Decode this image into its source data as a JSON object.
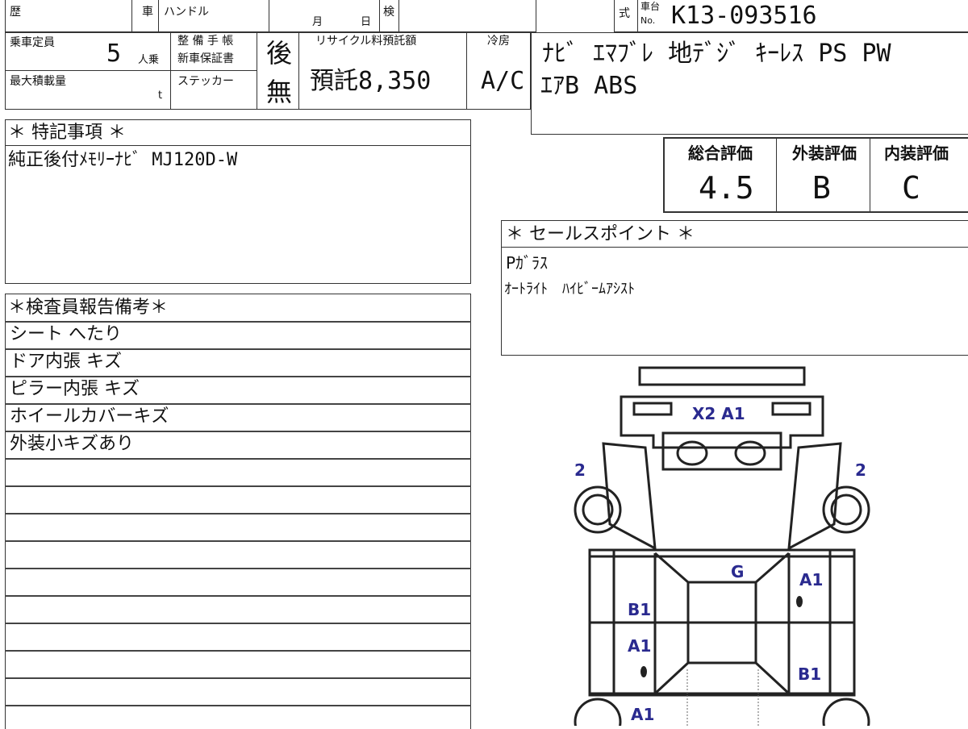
{
  "header": {
    "history_label": "歴",
    "car_label": "車",
    "handle_label": "ハンドル",
    "month_label": "月",
    "day_label": "日",
    "inspection_label": "検",
    "model_label": "式",
    "chassis_label_top": "車台",
    "chassis_label_bottom": "No.",
    "chassis_no": "K13-093516"
  },
  "specs": {
    "capacity_label": "乗車定員",
    "capacity_value": "5",
    "capacity_unit": "人乗",
    "maxload_label": "最大積載量",
    "maxload_unit": "t",
    "maint_label": "整 備 手 帳",
    "warranty_label": "新車保証書",
    "maint_value": "後",
    "sticker_label": "ステッカー",
    "sticker_value": "無",
    "recycle_label": "リサイクル料預託額",
    "recycle_value": "預託8,350",
    "aircon_label": "冷房",
    "aircon_value": "A/C"
  },
  "equipment": {
    "line1": "ﾅﾋﾞ ｴﾏﾌﾞﾚ 地ﾃﾞｼﾞ ｷｰﾚｽ PS PW",
    "line2": "ｴｱB ABS"
  },
  "ratings": {
    "overall_label": "総合評価",
    "overall_value": "4.5",
    "exterior_label": "外装評価",
    "exterior_value": "B",
    "interior_label": "内装評価",
    "interior_value": "C"
  },
  "special_notes": {
    "title": "＊ 特記事項 ＊",
    "text": "純正後付ﾒﾓﾘｰﾅﾋﾞ MJ120D-W"
  },
  "sales_points": {
    "title": "＊ セールスポイント ＊",
    "line1": "Pｶﾞﾗｽ",
    "line2": "ｵｰﾄﾗｲﾄ　ﾊｲﾋﾞｰﾑｱｼｽﾄ"
  },
  "inspector": {
    "title": "＊検査員報告備考＊",
    "remarks": [
      "シート へたり",
      "ドア内張 キズ",
      "ピラー内張 キズ",
      "ホイールカバーキズ",
      "外装小キズあり"
    ]
  },
  "diagram": {
    "front_bumper": "X2 A1",
    "front_left": "2",
    "front_right": "2",
    "roof": "G",
    "right_front_door": "A1",
    "left_front_door": "B1",
    "left_rear_door": "A1",
    "right_rear_door": "B1",
    "left_rear": "A1"
  }
}
